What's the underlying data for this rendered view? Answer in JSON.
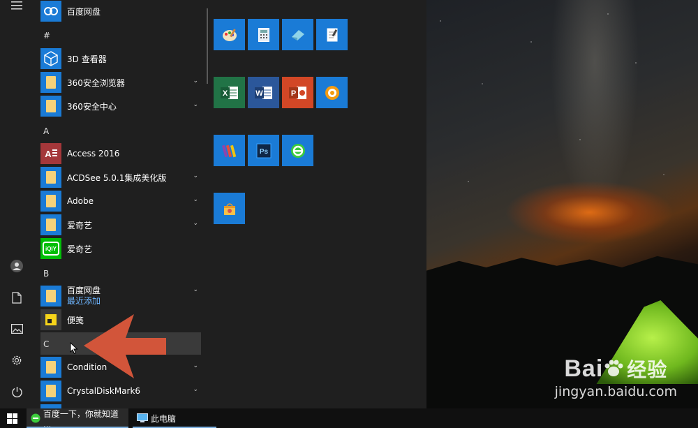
{
  "start_menu": {
    "pinned_top": {
      "label": "百度网盘",
      "icon": "baidu-netdisk-icon"
    },
    "sections": [
      {
        "header": "#",
        "items": [
          {
            "label": "3D 查看器",
            "icon": "3d-viewer-icon",
            "expandable": false
          },
          {
            "label": "360安全浏览器",
            "icon": "folder-icon",
            "expandable": true
          },
          {
            "label": "360安全中心",
            "icon": "folder-icon",
            "expandable": true
          }
        ]
      },
      {
        "header": "A",
        "items": [
          {
            "label": "Access 2016",
            "icon": "access-icon",
            "expandable": false
          },
          {
            "label": "ACDSee 5.0.1集成美化版",
            "icon": "folder-icon",
            "expandable": true
          },
          {
            "label": "Adobe",
            "icon": "folder-icon",
            "expandable": true
          },
          {
            "label": "爱奇艺",
            "icon": "folder-icon",
            "expandable": true
          },
          {
            "label": "爱奇艺",
            "icon": "iqiyi-icon",
            "expandable": false
          }
        ]
      },
      {
        "header": "B",
        "items": [
          {
            "label": "百度网盘",
            "sublabel": "最近添加",
            "icon": "folder-icon",
            "expandable": true
          },
          {
            "label": "便笺",
            "icon": "sticky-notes-icon",
            "expandable": false
          }
        ]
      },
      {
        "header": "C",
        "items": [
          {
            "label": "Condition",
            "icon": "folder-icon",
            "expandable": true
          },
          {
            "label": "CrystalDiskMark6",
            "icon": "folder-icon",
            "expandable": true
          }
        ]
      }
    ],
    "tiles": [
      {
        "name": "paint-tile",
        "color": "#1a7bd6"
      },
      {
        "name": "calculator-tile",
        "color": "#1a7bd6"
      },
      {
        "name": "eraser-tile",
        "color": "#1a7bd6"
      },
      {
        "name": "notepad-tile",
        "color": "#1a7bd6"
      },
      {
        "name": "excel-tile",
        "color": "#217346"
      },
      {
        "name": "word-tile",
        "color": "#2b579a"
      },
      {
        "name": "powerpoint-tile",
        "color": "#d24726"
      },
      {
        "name": "media-player-tile",
        "color": "#1a7bd6"
      },
      {
        "name": "winrar-tile",
        "color": "#1a7bd6"
      },
      {
        "name": "photoshop-tile",
        "color": "#1a7bd6"
      },
      {
        "name": "ie-360-tile",
        "color": "#1a7bd6"
      },
      {
        "name": "recycle-tile",
        "color": "#1a7bd6"
      }
    ]
  },
  "taskbar": {
    "items": [
      {
        "label": "百度一下，你就知道 ...",
        "icon": "360-browser-icon"
      },
      {
        "label": "此电脑",
        "icon": "this-pc-icon"
      }
    ]
  },
  "watermark": {
    "brand": "Bai",
    "brand_cn": "经验",
    "site": "jingyan.baidu.com"
  },
  "colors": {
    "accent": "#1a7bd6",
    "menu_bg": "#1f1f1f",
    "arrow": "#d2553a"
  }
}
